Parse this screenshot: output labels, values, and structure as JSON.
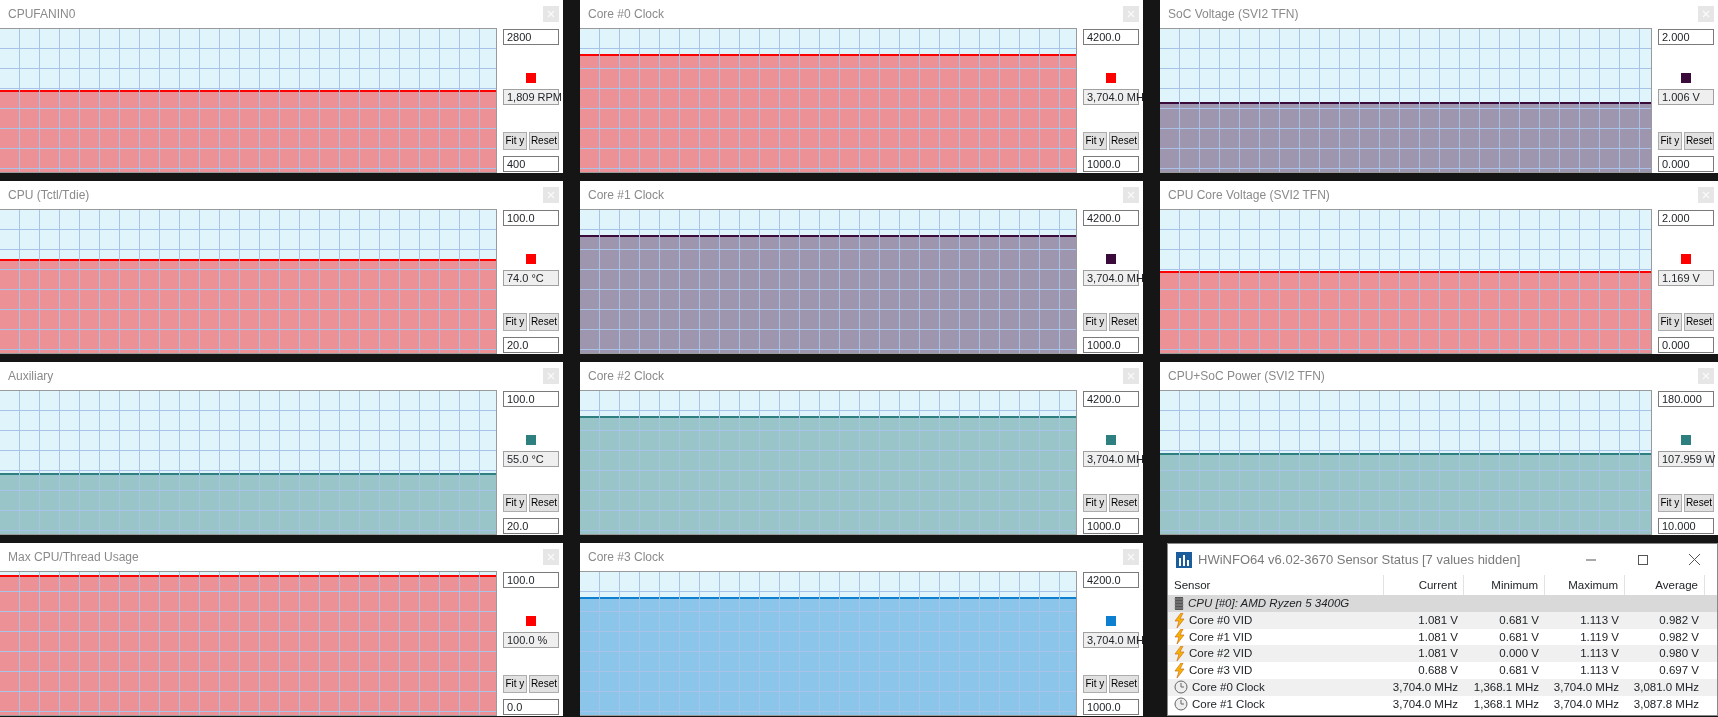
{
  "graphs": [
    {
      "title": "CPUFANIN0",
      "max": "2800",
      "current": "1,809 RPM",
      "min": "400",
      "color": "#ff0000",
      "fit_label": "Fit y",
      "reset_label": "Reset"
    },
    {
      "title": "Core #0 Clock",
      "max": "4200.0",
      "current": "3,704.0 MH",
      "min": "1000.0",
      "color": "#ff0000",
      "fit_label": "Fit y",
      "reset_label": "Reset"
    },
    {
      "title": "SoC Voltage (SVI2 TFN)",
      "max": "2.000",
      "current": "1.006 V",
      "min": "0.000",
      "color": "#3a0a3a",
      "fit_label": "Fit y",
      "reset_label": "Reset"
    },
    {
      "title": "CPU (Tctl/Tdie)",
      "max": "100.0",
      "current": "74.0 °C",
      "min": "20.0",
      "color": "#ff0000",
      "fit_label": "Fit y",
      "reset_label": "Reset"
    },
    {
      "title": "Core #1 Clock",
      "max": "4200.0",
      "current": "3,704.0 MH",
      "min": "1000.0",
      "color": "#3a0a3a",
      "fit_label": "Fit y",
      "reset_label": "Reset"
    },
    {
      "title": "CPU Core Voltage (SVI2 TFN)",
      "max": "2.000",
      "current": "1.169 V",
      "min": "0.000",
      "color": "#ff0000",
      "fit_label": "Fit y",
      "reset_label": "Reset"
    },
    {
      "title": "Auxiliary",
      "max": "100.0",
      "current": "55.0 °C",
      "min": "20.0",
      "color": "#2e7f7f",
      "fit_label": "Fit y",
      "reset_label": "Reset"
    },
    {
      "title": "Core #2 Clock",
      "max": "4200.0",
      "current": "3,704.0 MH",
      "min": "1000.0",
      "color": "#2e7f7f",
      "fit_label": "Fit y",
      "reset_label": "Reset"
    },
    {
      "title": "CPU+SoC Power (SVI2 TFN)",
      "max": "180.000",
      "current": "107.959 W",
      "min": "10.000",
      "color": "#2e7f7f",
      "fit_label": "Fit y",
      "reset_label": "Reset"
    },
    {
      "title": "Max CPU/Thread Usage",
      "max": "100.0",
      "current": "100.0 %",
      "min": "0.0",
      "color": "#ff0000",
      "fit_label": "Fit y",
      "reset_label": "Reset"
    },
    {
      "title": "Core #3 Clock",
      "max": "4200.0",
      "current": "3,704.0 MH",
      "min": "1000.0",
      "color": "#0d7fd0",
      "fit_label": "Fit y",
      "reset_label": "Reset"
    }
  ],
  "sensor_window": {
    "title": "HWiNFO64 v6.02-3670 Sensor Status [7 values hidden]",
    "columns": [
      "Sensor",
      "Current",
      "Minimum",
      "Maximum",
      "Average"
    ],
    "rows": [
      {
        "kind": "device",
        "sensor": "CPU [#0]: AMD Ryzen 5 3400G"
      },
      {
        "kind": "voltage",
        "sensor": "Core #0 VID",
        "values": [
          "1.081 V",
          "0.681 V",
          "1.113 V",
          "0.982 V"
        ]
      },
      {
        "kind": "voltage",
        "sensor": "Core #1 VID",
        "values": [
          "1.081 V",
          "0.681 V",
          "1.119 V",
          "0.982 V"
        ]
      },
      {
        "kind": "voltage",
        "sensor": "Core #2 VID",
        "values": [
          "1.081 V",
          "0.000 V",
          "1.113 V",
          "0.980 V"
        ]
      },
      {
        "kind": "voltage",
        "sensor": "Core #3 VID",
        "values": [
          "0.688 V",
          "0.681 V",
          "1.113 V",
          "0.697 V"
        ]
      },
      {
        "kind": "clock",
        "sensor": "Core #0 Clock",
        "values": [
          "3,704.0 MHz",
          "1,368.1 MHz",
          "3,704.0 MHz",
          "3,081.0 MHz"
        ]
      },
      {
        "kind": "clock",
        "sensor": "Core #1 Clock",
        "values": [
          "3,704.0 MHz",
          "1,368.1 MHz",
          "3,704.0 MHz",
          "3,087.8 MHz"
        ]
      }
    ]
  }
}
